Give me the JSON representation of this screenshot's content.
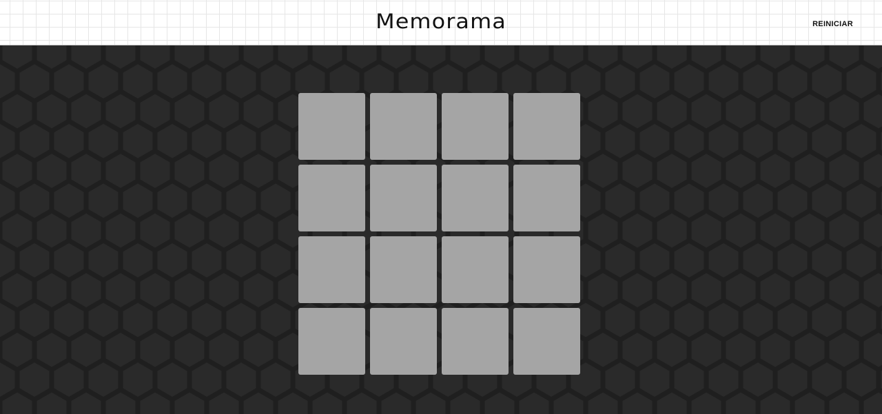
{
  "header": {
    "title": "Memorama",
    "restart_label": "REINICIAR"
  },
  "colors": {
    "card_back": "#a5a5a5",
    "background": "#2a2a2a",
    "hex_gap": "#1f1f1f"
  },
  "board": {
    "rows": 4,
    "cols": 4,
    "cards": [
      {
        "face_down": true
      },
      {
        "face_down": true
      },
      {
        "face_down": true
      },
      {
        "face_down": true
      },
      {
        "face_down": true
      },
      {
        "face_down": true
      },
      {
        "face_down": true
      },
      {
        "face_down": true
      },
      {
        "face_down": true
      },
      {
        "face_down": true
      },
      {
        "face_down": true
      },
      {
        "face_down": true
      },
      {
        "face_down": true
      },
      {
        "face_down": true
      },
      {
        "face_down": true
      },
      {
        "face_down": true
      }
    ]
  }
}
